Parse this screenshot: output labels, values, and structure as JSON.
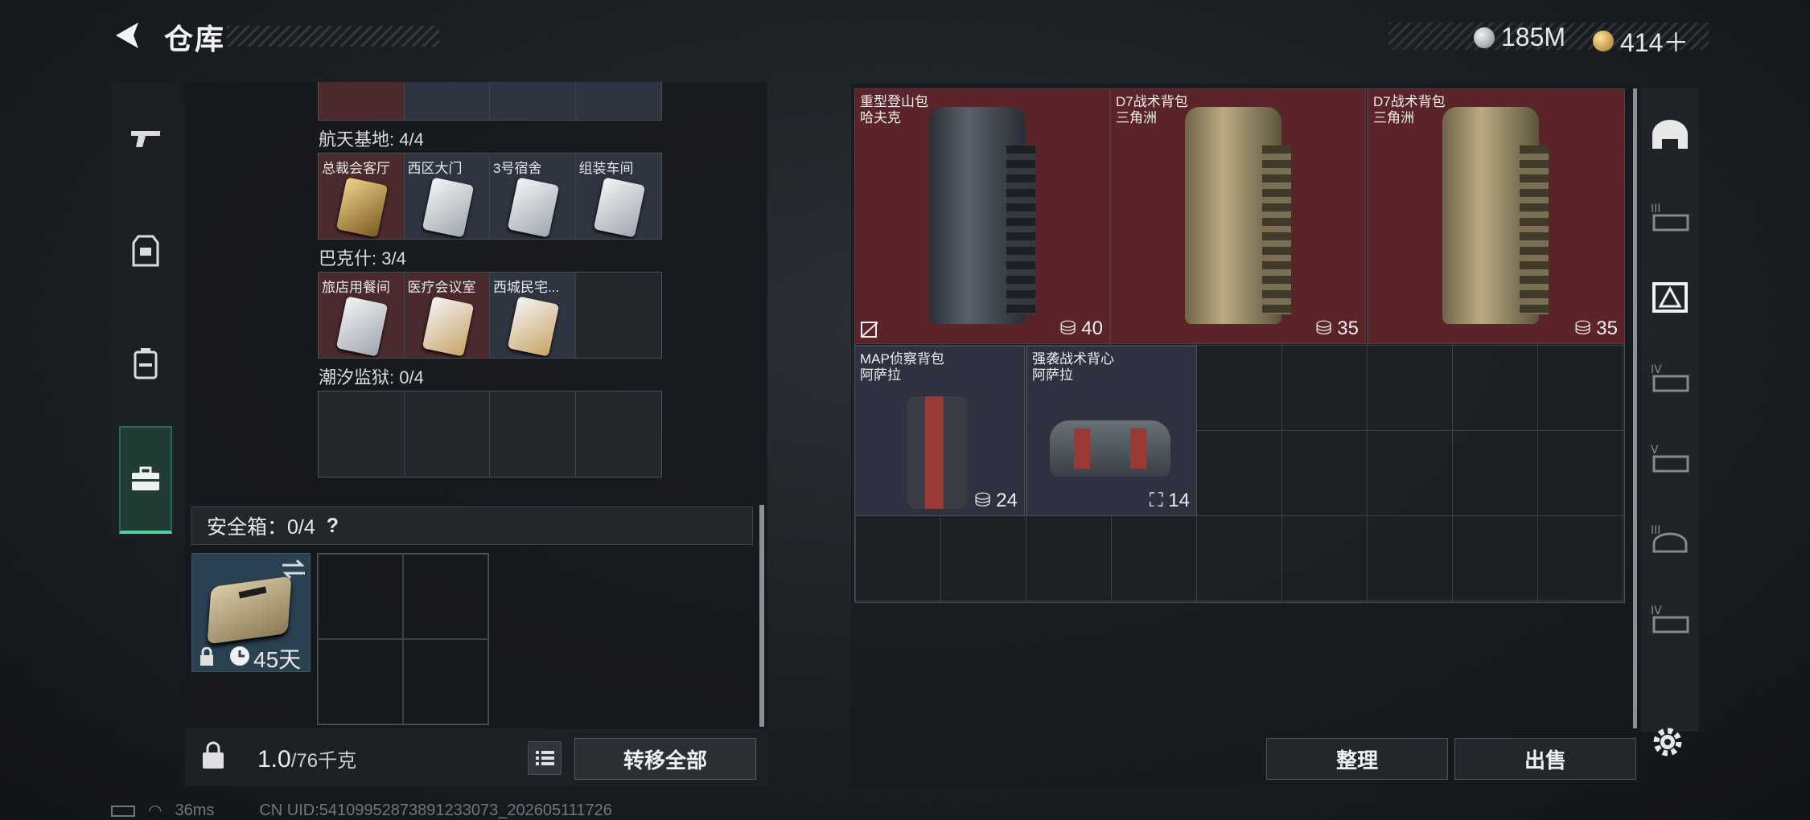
{
  "header": {
    "title": "仓库"
  },
  "currency": {
    "silver": "185M",
    "gold": "414＋"
  },
  "left_nav": {
    "tabs": [
      "weapon-icon",
      "armor-icon",
      "backpack-icon",
      "case-icon"
    ],
    "active": 3
  },
  "key_groups": [
    {
      "label": "航天基地: 4/4",
      "cells": [
        {
          "name": "总裁会客厅",
          "color": "red",
          "card": "gold"
        },
        {
          "name": "西区大门",
          "color": "blue",
          "card": "white"
        },
        {
          "name": "3号宿舍",
          "color": "blue",
          "card": "white"
        },
        {
          "name": "组装车间",
          "color": "blue",
          "card": "white"
        }
      ]
    },
    {
      "label": "巴克什: 3/4",
      "cells": [
        {
          "name": "旅店用餐间",
          "color": "red",
          "card": "white"
        },
        {
          "name": "医疗会议室",
          "color": "red",
          "card": "gold"
        },
        {
          "name": "西城民宅...",
          "color": "blue",
          "card": "white"
        },
        {
          "name": "",
          "color": "empty",
          "card": ""
        }
      ]
    },
    {
      "label": "潮汐监狱: 0/4",
      "cells": [
        {
          "name": "",
          "color": "empty",
          "card": ""
        },
        {
          "name": "",
          "color": "empty",
          "card": ""
        },
        {
          "name": "",
          "color": "empty",
          "card": ""
        },
        {
          "name": "",
          "color": "empty",
          "card": ""
        }
      ]
    }
  ],
  "safe_box": {
    "label": "安全箱：0/4",
    "help": "?",
    "duration": "45天"
  },
  "bottom": {
    "weight": "1.0",
    "weight_max": "/76千克",
    "transfer_all": "转移全部"
  },
  "stash_items": [
    {
      "name": "重型登山包",
      "maker": "哈夫克",
      "count": "40",
      "style": "red",
      "bag": "dark"
    },
    {
      "name": "D7战术背包",
      "maker": "三角洲",
      "count": "35",
      "style": "red",
      "bag": "tan"
    },
    {
      "name": "D7战术背包",
      "maker": "三角洲",
      "count": "35",
      "style": "red",
      "bag": "tan"
    },
    {
      "name": "MAP侦察背包",
      "maker": "阿萨拉",
      "count": "24",
      "style": "blue",
      "bag": "redpack"
    },
    {
      "name": "强袭战术背心",
      "maker": "阿萨拉",
      "count": "14",
      "style": "blue",
      "bag": "vest"
    }
  ],
  "actions": {
    "arrange": "整理",
    "sell": "出售"
  },
  "right_nav": [
    "helmet-icon",
    "armor-tier-III-icon",
    "rig-icon",
    "armor-tier-IV-icon",
    "armor-tier-V-icon",
    "helmet-tier-III-icon",
    "case-tier-IV-icon"
  ],
  "status": {
    "ping": "36ms",
    "uid": "CN UID:54109952873891233073_202605111726"
  },
  "colors": {
    "accent": "#4fd1a0",
    "red_slot": "#5a2429",
    "blue_slot": "#2e3240"
  }
}
